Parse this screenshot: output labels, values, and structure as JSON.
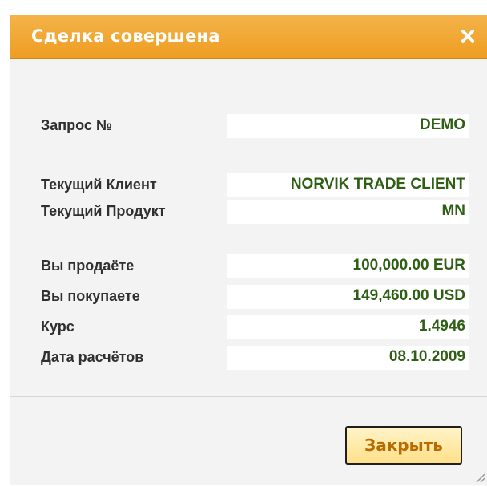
{
  "dialog": {
    "title": "Сделка совершена",
    "close_icon": "close-icon",
    "colors": {
      "titlebar": "#ee9d22",
      "value_text": "#2e5f14",
      "button_text": "#b76b00",
      "button_bg": "#ffe08a"
    }
  },
  "fields": {
    "request": {
      "label": "Запрос №",
      "value": "DEMO"
    },
    "client": {
      "label": "Текущий Клиент",
      "value": "NORVIK TRADE CLIENT"
    },
    "product": {
      "label": "Текущий Продукт",
      "value": "MN"
    },
    "sell": {
      "label": "Вы продаёте",
      "value": "100,000.00 EUR"
    },
    "buy": {
      "label": "Вы покупаете",
      "value": "149,460.00 USD"
    },
    "rate": {
      "label": "Курс",
      "value": "1.4946"
    },
    "settlement_date": {
      "label": "Дата расчётов",
      "value": "08.10.2009"
    }
  },
  "footer": {
    "close_label": "Закрыть"
  }
}
